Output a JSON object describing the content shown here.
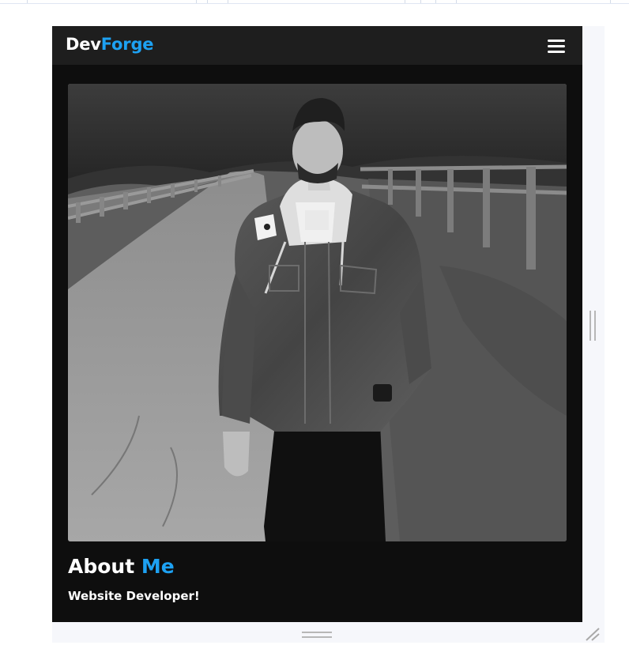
{
  "navbar": {
    "brand_primary": "Dev",
    "brand_accent": "Forge",
    "menu_icon": "hamburger-menu-icon"
  },
  "hero": {
    "image_icon": "profile-photo",
    "style": "black-and-white"
  },
  "about": {
    "title_primary": "About",
    "title_accent": "Me",
    "subtitle": "Website Developer!"
  },
  "colors": {
    "accent": "#1da1f2",
    "navbar_bg": "#1e1e1e",
    "page_bg": "#0e0e0e",
    "text": "#ffffff",
    "frame_bg": "#f6f7fb"
  },
  "resize_handles": [
    "vertical-resize-grip-icon",
    "horizontal-resize-grip-icon",
    "corner-resize-grip-icon"
  ]
}
